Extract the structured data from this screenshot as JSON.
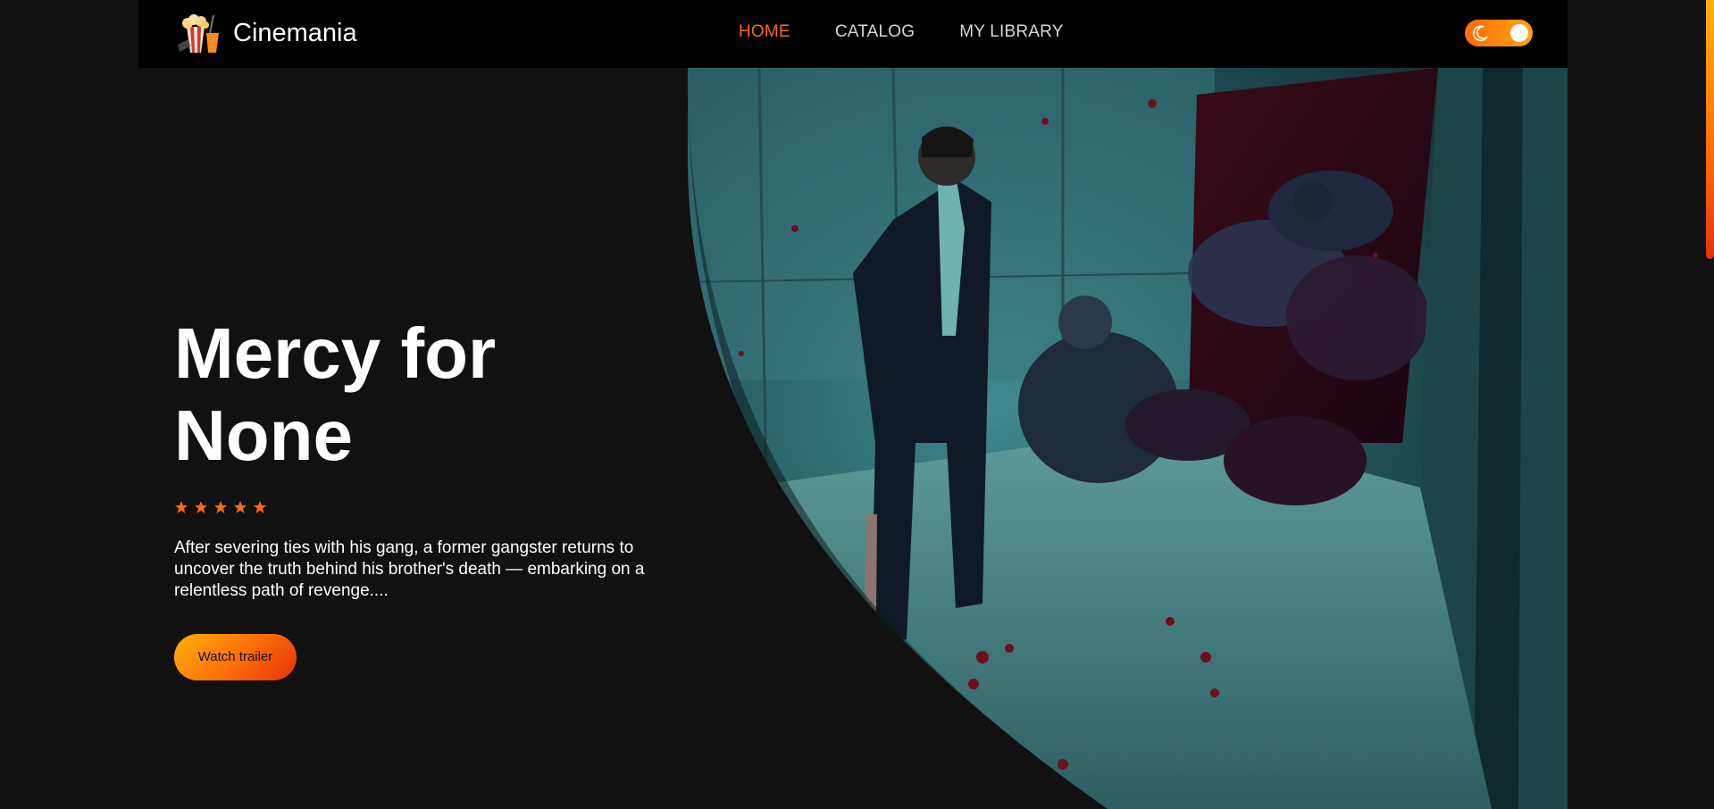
{
  "header": {
    "logo_text": "Cinemania",
    "nav": [
      {
        "label": "HOME",
        "active": true
      },
      {
        "label": "CATALOG",
        "active": false
      },
      {
        "label": "MY LIBRARY",
        "active": false
      }
    ],
    "theme_toggle": {
      "icon": "moon-icon",
      "state": "dark"
    }
  },
  "hero": {
    "title": "Mercy for None",
    "rating": {
      "stars": 5,
      "max": 5
    },
    "description": "After severing ties with his gang, a former gangster returns to uncover the truth behind his brother's death — embarking on a relentless path of revenge....",
    "button_label": "Watch trailer"
  },
  "colors": {
    "accent": "#ff6b08",
    "accent_light": "#ffa50a",
    "background": "#111111",
    "header_bg": "#000000",
    "text": "#ffffff",
    "nav_inactive": "#d7d7d7"
  }
}
